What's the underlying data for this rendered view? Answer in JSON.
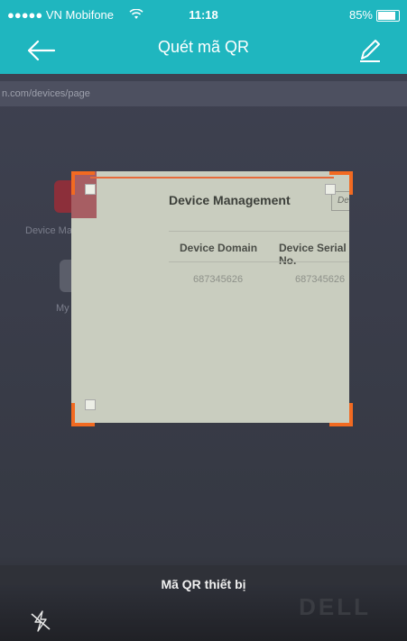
{
  "status_bar": {
    "carrier": "●●●●● VN Mobifone",
    "time": "11:18",
    "battery": "85%"
  },
  "header": {
    "title": "Quét mã QR"
  },
  "background": {
    "url_text": "n.com/devices/page",
    "side_items": [
      "Device Management",
      "My Account"
    ],
    "brand": "DELL"
  },
  "scan_frame": {
    "title": "Device Management",
    "search_placeholder": "Device Serial N",
    "headers": [
      "Device Domain",
      "Device Serial No."
    ],
    "row": [
      "687345626",
      "687345626"
    ]
  },
  "scan_label": "Mã QR thiết bị",
  "colors": {
    "accent": "#1fb6bf",
    "frame_corner": "#f26a21"
  },
  "icons": [
    "back-arrow-icon",
    "edit-pencil-icon",
    "wifi-icon",
    "battery-icon",
    "flash-off-icon"
  ]
}
